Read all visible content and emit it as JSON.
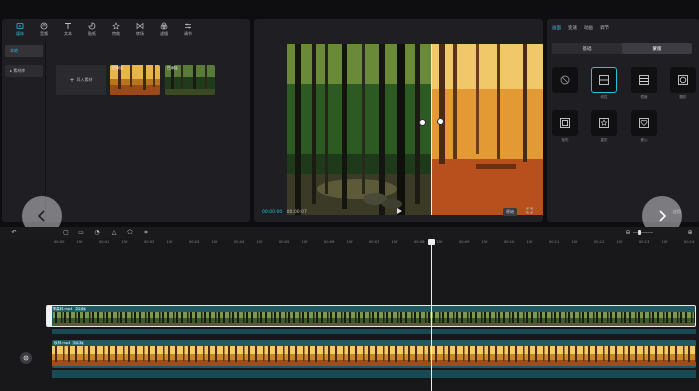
{
  "toolbar_tabs": [
    {
      "label": "媒体",
      "icon": "media-icon",
      "active": true
    },
    {
      "label": "音频",
      "icon": "audio-icon",
      "active": false
    },
    {
      "label": "文本",
      "icon": "text-icon",
      "active": false
    },
    {
      "label": "贴纸",
      "icon": "sticker-icon",
      "active": false
    },
    {
      "label": "特效",
      "icon": "effects-icon",
      "active": false
    },
    {
      "label": "转场",
      "icon": "transition-icon",
      "active": false
    },
    {
      "label": "滤镜",
      "icon": "filter-icon",
      "active": false
    },
    {
      "label": "调节",
      "icon": "adjust-icon",
      "active": false
    }
  ],
  "side_nav": [
    {
      "label": "本地",
      "active": true
    },
    {
      "label": "▸ 素材库",
      "active": false
    }
  ],
  "media": {
    "import_label": "导入素材",
    "thumbs": [
      {
        "caption": "已添加"
      },
      {
        "caption": "已添加"
      }
    ]
  },
  "preview": {
    "current_time": "00:00:00",
    "total_time": "00:00:07",
    "ratio_label": "原始"
  },
  "props": {
    "tabs": [
      {
        "label": "画面",
        "active": true
      },
      {
        "label": "变速",
        "active": false
      },
      {
        "label": "动画",
        "active": false
      },
      {
        "label": "调节",
        "active": false
      }
    ],
    "subtabs": [
      {
        "label": "基础",
        "active": false
      },
      {
        "label": "蒙版",
        "active": true
      }
    ],
    "masks": [
      {
        "label": "",
        "icon": "none-icon",
        "selected": false
      },
      {
        "label": "线性",
        "icon": "linear-mask-icon",
        "selected": true
      },
      {
        "label": "镜面",
        "icon": "mirror-mask-icon",
        "selected": false
      },
      {
        "label": "圆形",
        "icon": "circle-mask-icon",
        "selected": false
      },
      {
        "label": "矩形",
        "icon": "rect-mask-icon",
        "selected": false
      },
      {
        "label": "星形",
        "icon": "star-mask-icon",
        "selected": false
      },
      {
        "label": "爱心",
        "icon": "heart-mask-icon",
        "selected": false
      }
    ],
    "apply_label": "应用"
  },
  "timeline": {
    "ticks": [
      "00:00",
      "15f",
      "00:01",
      "15f",
      "00:02",
      "15f",
      "00:03",
      "15f",
      "00:04",
      "15f",
      "00:05",
      "15f",
      "00:06",
      "15f",
      "00:07",
      "15f",
      "00:08",
      "15f",
      "00:09",
      "15f",
      "00:10",
      "15f",
      "00:11",
      "15f",
      "00:12",
      "15f",
      "00:13",
      "15f",
      "00:14",
      "15f"
    ],
    "tracks": [
      {
        "name": "夏季森林.mp4",
        "duration": "21.6s"
      },
      {
        "name": "秋林.mp4",
        "duration": "54.3s"
      }
    ]
  },
  "colors": {
    "accent": "#23c3d8",
    "panel": "#1f1f23",
    "background": "#0e0e10"
  }
}
